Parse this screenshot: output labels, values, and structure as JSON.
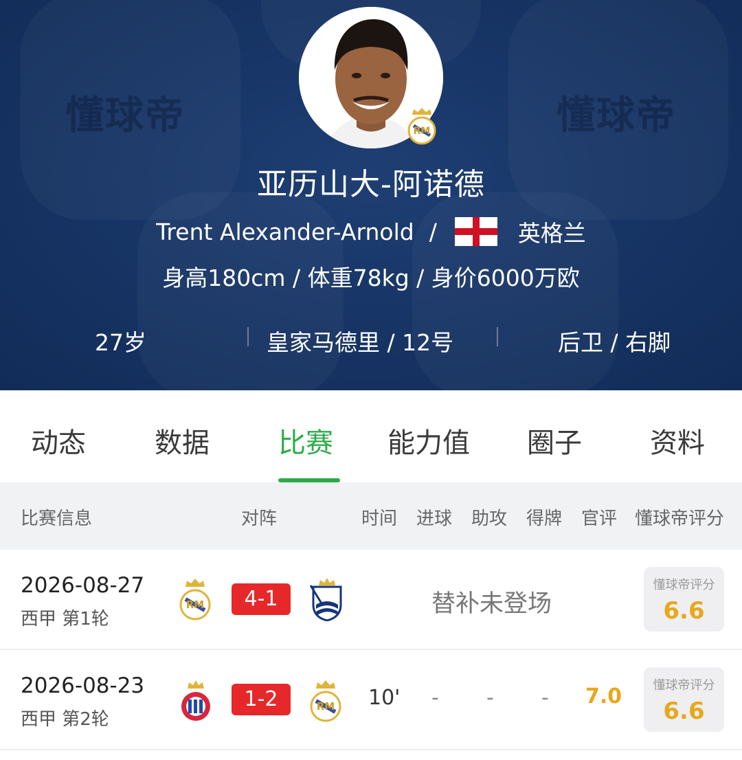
{
  "header": {
    "watermark": "懂球帝",
    "name_cn": "亚历山大-阿诺德",
    "name_en": "Trent Alexander-Arnold",
    "separator": "/",
    "nationality": "英格兰",
    "bio": "身高180cm / 体重78kg / 身价6000万欧",
    "age": "27岁",
    "club_number": "皇家马德里 / 12号",
    "position_foot": "后卫 / 右脚",
    "colors": {
      "background": "#173566",
      "text": "#ffffff"
    }
  },
  "tabs": [
    {
      "label": "动态"
    },
    {
      "label": "数据"
    },
    {
      "label": "比赛",
      "active": true
    },
    {
      "label": "能力值"
    },
    {
      "label": "圈子"
    },
    {
      "label": "资料"
    }
  ],
  "table": {
    "columns": {
      "match_info": "比赛信息",
      "fixture": "对阵",
      "minutes": "时间",
      "goals": "进球",
      "assists": "助攻",
      "cards": "得牌",
      "official_rating": "官评",
      "dongqiudi_rating": "懂球帝评分"
    },
    "rows": [
      {
        "date": "2026-08-27",
        "league": "西甲 第1轮",
        "home_crest": "real-madrid-crest",
        "score": "4-1",
        "away_crest": "real-sociedad-crest",
        "status": "替补未登场",
        "rating_label": "懂球帝评分",
        "rating": "6.6"
      },
      {
        "date": "2026-08-23",
        "league": "西甲 第2轮",
        "home_crest": "espanyol-crest",
        "score": "1-2",
        "away_crest": "real-madrid-crest",
        "minutes": "10'",
        "goals": "-",
        "assists": "-",
        "cards": "-",
        "official_rating": "7.0",
        "rating_label": "懂球帝评分",
        "rating": "6.6"
      }
    ]
  },
  "colors": {
    "accent": "#2eaa4a",
    "score_bg": "#e6282b",
    "rating": "#e7a81b"
  }
}
